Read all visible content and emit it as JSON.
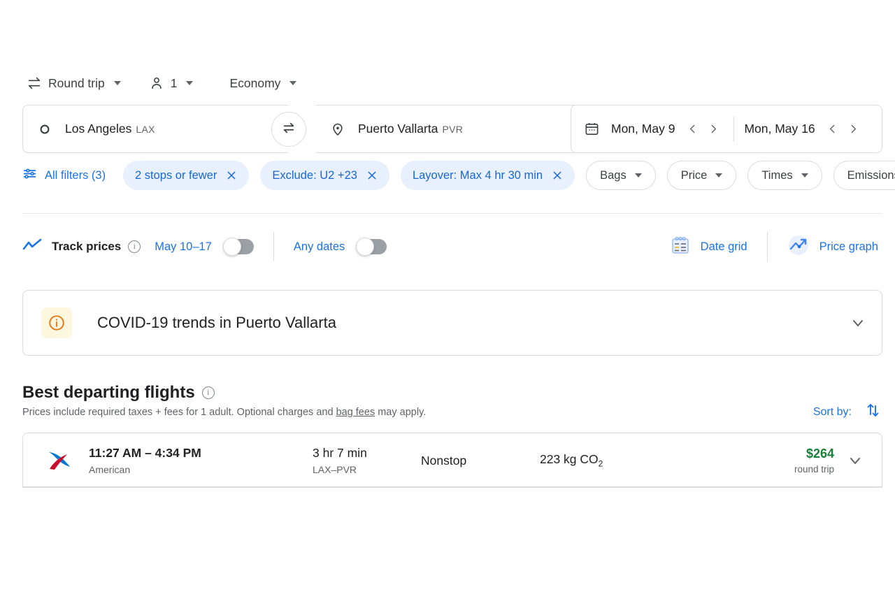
{
  "trip_options": [
    {
      "icon": "swap-horizontal-icon",
      "label": "Round trip",
      "name": "trip-type-selector"
    },
    {
      "icon": "person-icon",
      "label": "1",
      "name": "passengers-selector"
    },
    {
      "icon": "none",
      "label": "Economy",
      "name": "cabin-class-selector"
    }
  ],
  "search": {
    "origin": {
      "city": "Los Angeles",
      "code": "LAX",
      "icon": "circle-icon"
    },
    "destination": {
      "city": "Puerto Vallarta",
      "code": "PVR",
      "icon": "location-pin-icon"
    },
    "swap_icon": "swap-arrows-icon",
    "calendar_icon": "calendar-icon",
    "depart_date": "Mon, May 9",
    "return_date": "Mon, May 16",
    "prev_arrow": "chevron-left-icon",
    "next_arrow": "chevron-right-icon"
  },
  "filters": {
    "all_filters_label": "All filters (3)",
    "all_filters_icon": "tune-icon",
    "chips": [
      {
        "label": "2 stops or fewer",
        "type": "active",
        "clipped": true,
        "name": "chip-stops"
      },
      {
        "label": "Exclude: U2 +23",
        "type": "active",
        "clipped": false,
        "name": "chip-exclude-airlines"
      },
      {
        "label": "Layover: Max 4 hr 30 min",
        "type": "active",
        "clipped": false,
        "name": "chip-layover"
      },
      {
        "label": "Bags",
        "type": "dropdown",
        "clipped": false,
        "name": "chip-bags"
      },
      {
        "label": "Price",
        "type": "dropdown",
        "clipped": false,
        "name": "chip-price"
      },
      {
        "label": "Times",
        "type": "dropdown",
        "clipped": false,
        "name": "chip-times"
      },
      {
        "label": "Emissions",
        "type": "dropdown",
        "clipped": true,
        "name": "chip-emissions"
      }
    ]
  },
  "track_prices": {
    "icon": "trending-line-icon",
    "label": "Track prices",
    "info_icon": "info-icon",
    "date_range_label": "May 10–17",
    "date_range_toggle": "off",
    "any_dates_label": "Any dates",
    "any_dates_toggle": "off"
  },
  "tools": {
    "date_grid": {
      "label": "Date grid",
      "icon": "date-grid-icon"
    },
    "price_graph": {
      "label": "Price graph",
      "icon": "price-graph-icon"
    }
  },
  "covid_banner": {
    "icon": "info-outline-icon",
    "title": "COVID-19 trends in Puerto Vallarta",
    "expand_icon": "chevron-down-icon"
  },
  "results": {
    "title": "Best departing flights",
    "title_info_icon": "info-icon",
    "subtitle_before": "Prices include required taxes + fees for 1 adult. Optional charges and ",
    "subtitle_link": "bag fees",
    "subtitle_after": " may apply.",
    "sort_label": "Sort by:",
    "sort_icon": "sort-arrows-icon",
    "flights": [
      {
        "airline_logo": "american-airlines-logo",
        "times": "11:27 AM – 4:34 PM",
        "airline": "American",
        "duration": "3 hr 7 min",
        "route": "LAX–PVR",
        "stops": "Nonstop",
        "emissions_value": "223 kg CO",
        "emissions_sub": "2",
        "price": "$264",
        "price_sub": "round trip",
        "expand_icon": "chevron-down-icon"
      }
    ]
  },
  "colors": {
    "accent_blue": "#1a73e8",
    "chip_active_bg": "#e8f0fe",
    "chip_active_text": "#1967d2",
    "price_green": "#188038",
    "covid_icon": "#e8710a",
    "covid_icon_bg": "#fef7e0",
    "border": "#dadce0"
  }
}
